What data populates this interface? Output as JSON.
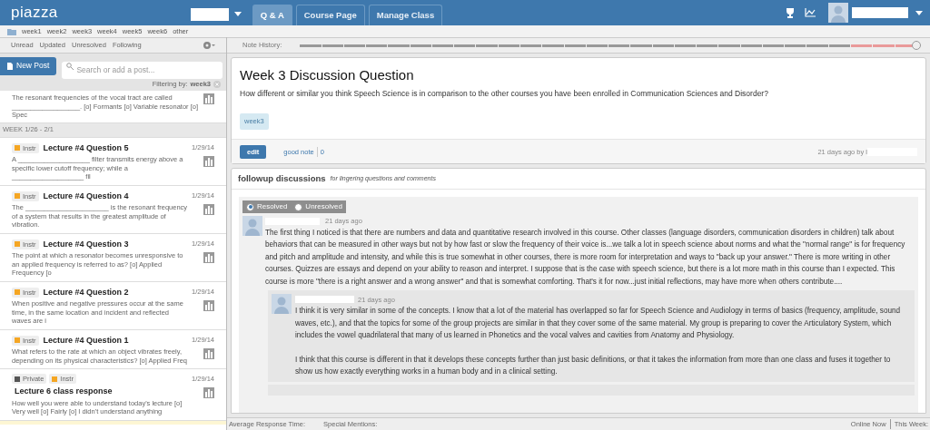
{
  "topbar": {
    "logo": "piazza",
    "tabs": [
      {
        "label": "Q & A",
        "selected": true
      },
      {
        "label": "Course Page",
        "selected": false
      },
      {
        "label": "Manage Class",
        "selected": false
      }
    ]
  },
  "folders": [
    "week1",
    "week2",
    "week3",
    "week4",
    "week5",
    "week6",
    "other"
  ],
  "filters": [
    "Unread",
    "Updated",
    "Unresolved",
    "Following"
  ],
  "note_history": {
    "label": "Note History:",
    "level": 1
  },
  "new_post": "New Post",
  "search": {
    "placeholder": "Search or add a post..."
  },
  "filtering": {
    "label": "Filtering by:",
    "value": "week3"
  },
  "first_post_snippet": "The resonant frequencies of the vocal tract are called __________________. [o] Formants [o] Variable resonator [o] Spec",
  "group": "WEEK 1/26 - 2/1",
  "posts": [
    {
      "tags": [
        {
          "label": "Instr",
          "color": "#f5a623"
        }
      ],
      "title": "Lecture #4 Question 5",
      "snippet": "A ___________________ filter transmits energy above a specific lower cutoff frequency; while a ___________________ fil",
      "date": "1/29/14"
    },
    {
      "tags": [
        {
          "label": "Instr",
          "color": "#f5a623"
        }
      ],
      "title": "Lecture #4 Question 4",
      "snippet": "The ______________________ is the resonant frequency of a system that results in the greatest amplitude of vibration.",
      "date": "1/29/14"
    },
    {
      "tags": [
        {
          "label": "Instr",
          "color": "#f5a623"
        }
      ],
      "title": "Lecture #4 Question 3",
      "snippet": "The point at which a resonator becomes unresponsive to an applied frequency is referred to as? [o] Applied Frequency [o",
      "date": "1/29/14"
    },
    {
      "tags": [
        {
          "label": "Instr",
          "color": "#f5a623"
        }
      ],
      "title": "Lecture #4 Question 2",
      "snippet": "When positive and negative pressures occur at the same time, in the same location and incident and reflected waves are i",
      "date": "1/29/14"
    },
    {
      "tags": [
        {
          "label": "Instr",
          "color": "#f5a623"
        }
      ],
      "title": "Lecture #4 Question 1",
      "snippet": "What refers to the rate at which an object vibrates freely, depending on its physical characteristics? [o] Applied Freq",
      "date": "1/29/14"
    },
    {
      "tags": [
        {
          "label": "Private",
          "color": "#555555"
        },
        {
          "label": "Instr",
          "color": "#f5a623"
        }
      ],
      "title": "Lecture 6 class response",
      "snippet": "How well you were able to understand today's lecture [o] Very well [o] Fairly [o] I didn't understand anything",
      "date": "1/29/14"
    }
  ],
  "note": {
    "title": "Week 3 Discussion Question",
    "body": "How different or similar you think Speech Science is in comparison to the other courses you have been enrolled in Communication Sciences and Disorder?",
    "tag": "week3",
    "edit": "edit",
    "good_note": "good note",
    "count": "0",
    "meta": "21 days ago by l"
  },
  "followups": {
    "title": "followup discussions",
    "subtitle": "for lingering questions and comments",
    "options": [
      {
        "label": "Resolved",
        "selected": true
      },
      {
        "label": "Unresolved",
        "selected": false
      }
    ],
    "post": {
      "time": "21 days ago",
      "text": "The first thing I noticed is that there are numbers and data and quantitative research involved in this course. Other classes (language disorders, communication disorders in children) talk about behaviors that can be measured in other ways but not by how fast or slow the frequency of their voice is...we talk a lot in speech science about norms and what the \"normal range\" is for frequency and pitch and amplitude and intensity, and while this is true somewhat in other courses, there is more room for interpretation and ways to \"back up your answer.\" There is more writing in other courses. Quizzes are essays and depend on your ability to reason and interpret. I suppose that is the case with speech science, but there is a lot more math in this course than I expected. This course is more \"there is a right answer and a wrong answer\" and that is somewhat comforting. That's it for now...just initial reflections, may have more when others contribute....",
      "reply": {
        "time": "21 days ago",
        "paragraphs": [
          "I think it is very similar in some of the concepts. I know that a lot of the material has overlapped so far for Speech Science and Audiology in terms of basics (frequency, amplitude, sound waves, etc.), and that the topics for some of the group projects are similar in that they cover some of the same material. My group is preparing to cover the Articulatory System, which includes the vowel quadrilateral that many of us learned in Phonetics and the vocal valves and cavities from Anatomy and Physiology.",
          "I think that this course is different in that it develops these concepts further than just basic definitions, or that it takes the information from more than one class and fuses it together to show us how exactly everything works in a human body and in a clinical setting."
        ]
      }
    }
  },
  "footer": {
    "left": [
      "Average Response Time:",
      "Special Mentions:"
    ],
    "right": [
      "Online Now",
      "This Week:"
    ]
  }
}
